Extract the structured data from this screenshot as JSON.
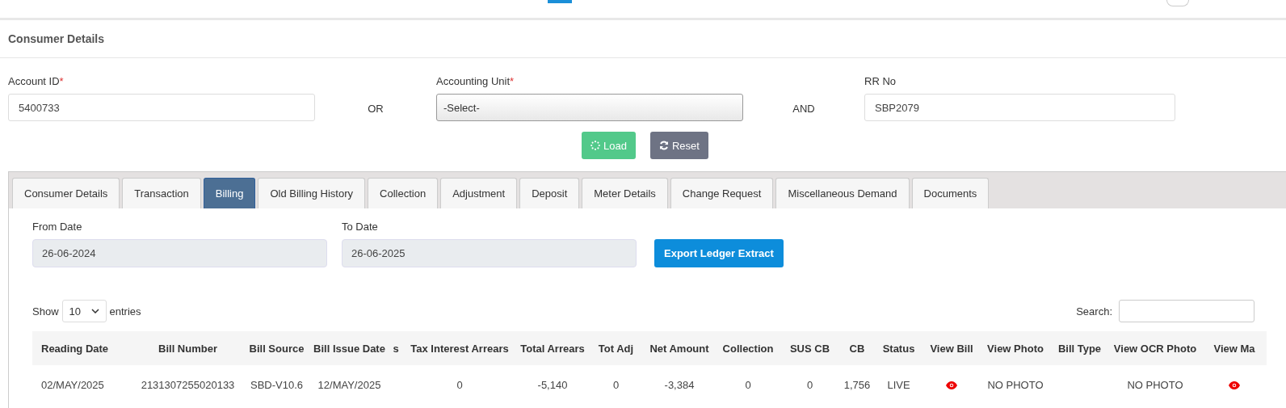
{
  "section_title": "Consumer Details",
  "form": {
    "account_id": {
      "label": "Account ID",
      "required_mark": "*",
      "value": "5400733"
    },
    "or_label": "OR",
    "accounting_unit": {
      "label": "Accounting Unit",
      "required_mark": "*",
      "value": "-Select-"
    },
    "and_label": "AND",
    "rr_no": {
      "label": "RR No",
      "value": "SBP2079"
    },
    "buttons": [
      {
        "kind": "load",
        "label": "Load"
      },
      {
        "kind": "reset",
        "label": "Reset"
      }
    ]
  },
  "tabs": [
    {
      "label": "Consumer Details",
      "selected": false
    },
    {
      "label": "Transaction",
      "selected": false
    },
    {
      "label": "Billing",
      "selected": true
    },
    {
      "label": "Old Billing History",
      "selected": false
    },
    {
      "label": "Collection",
      "selected": false
    },
    {
      "label": "Adjustment",
      "selected": false
    },
    {
      "label": "Deposit",
      "selected": false
    },
    {
      "label": "Meter Details",
      "selected": false
    },
    {
      "label": "Change Request",
      "selected": false
    },
    {
      "label": "Miscellaneous Demand",
      "selected": false
    },
    {
      "label": "Documents",
      "selected": false
    }
  ],
  "billing": {
    "from_date": {
      "label": "From Date",
      "value": "26-06-2024"
    },
    "to_date": {
      "label": "To Date",
      "value": "26-06-2025"
    },
    "export_button": "Export Ledger Extract",
    "show_label": "Show",
    "page_size": "10",
    "entries_label": "entries",
    "search_label": "Search:",
    "table": {
      "columns": [
        "Reading Date",
        "Bill Number",
        "Bill Source",
        "Bill Issue Date",
        "s",
        "Tax Interest Arrears",
        "Total Arrears",
        "Tot Adj",
        "Net Amount",
        "Collection",
        "SUS CB",
        "CB",
        "Status",
        "View Bill",
        "View Photo",
        "Bill Type",
        "View OCR Photo",
        "View Ma"
      ],
      "rows": [
        [
          {
            "kind": "text",
            "text": "02/MAY/2025"
          },
          {
            "kind": "text",
            "text": "2131307255020133"
          },
          {
            "kind": "text",
            "text": "SBD-V10.6"
          },
          {
            "kind": "text",
            "text": "12/MAY/2025"
          },
          {
            "kind": "empty"
          },
          {
            "kind": "text",
            "text": "0"
          },
          {
            "kind": "text",
            "text": "-5,140"
          },
          {
            "kind": "text",
            "text": "0"
          },
          {
            "kind": "text",
            "text": "-3,384"
          },
          {
            "kind": "text",
            "text": "0"
          },
          {
            "kind": "text",
            "text": "0"
          },
          {
            "kind": "text",
            "text": "1,756"
          },
          {
            "kind": "text",
            "text": "LIVE"
          },
          {
            "kind": "view"
          },
          {
            "kind": "text",
            "text": "NO PHOTO"
          },
          {
            "kind": "empty"
          },
          {
            "kind": "text",
            "text": "NO PHOTO"
          },
          {
            "kind": "view"
          }
        ]
      ]
    }
  }
}
